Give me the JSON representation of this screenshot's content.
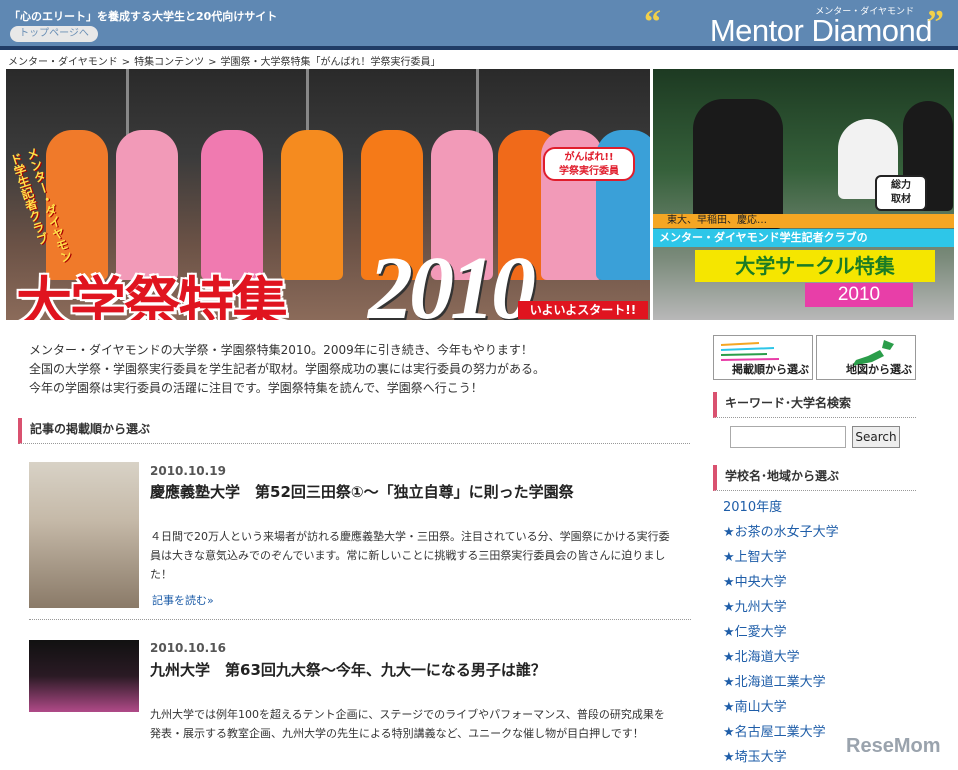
{
  "header": {
    "tagline": "「心のエリート」を養成する大学生と20代向けサイト",
    "top_link": "トップページへ",
    "logo_sub": "メンター・ダイヤモンド",
    "logo": "Mentor Diamond",
    "quote_open": "“",
    "quote_close": "”"
  },
  "breadcrumb": [
    "メンター・ダイヤモンド",
    "特集コンテンツ",
    "学園祭・大学祭特集「がんばれ！学祭実行委員」"
  ],
  "breadcrumb_sep": ">",
  "hero_left": {
    "club_label": "メンター・ダイヤモンド学生記者クラブ",
    "badge": "がんばれ!!\n学祭実行委員",
    "title": "大学祭特集",
    "year": "2010",
    "start": "いよいよスタート!!"
  },
  "hero_right": {
    "badge": "総力\n取材",
    "orange": "東大、早稲田、慶応…",
    "cyan": "メンター・ダイヤモンド学生記者クラブの",
    "yellow": "大学サークル特集",
    "pink": "2010"
  },
  "intro": [
    "メンター・ダイヤモンドの大学祭・学園祭特集2010。2009年に引き続き、今年もやります！",
    "全国の大学祭・学園祭実行委員を学生記者が取材。学園祭成功の裏には実行委員の努力がある。",
    "今年の学園祭は実行委員の活躍に注目です。学園祭特集を読んで、学園祭へ行こう！"
  ],
  "section_order": "記事の掲載順から選ぶ",
  "articles": [
    {
      "date": "2010.10.19",
      "title": "慶應義塾大学　第52回三田祭①～「独立自尊」に則った学園祭",
      "desc": "４日間で20万人という来場者が訪れる慶應義塾大学・三田祭。注目されている分、学園祭にかける実行委員は大きな意気込みでのぞんでいます。常に新しいことに挑戦する三田祭実行委員会の皆さんに迫りました！",
      "more": "記事を読む»"
    },
    {
      "date": "2010.10.16",
      "title": "九州大学　第63回九大祭～今年、九大一になる男子は誰？",
      "desc": "九州大学では例年100を超えるテント企画に、ステージでのライブやパフォーマンス、普段の研究成果を発表・展示する教室企画、九州大学の先生による特別講義など、ユニークな催し物が目白押しです！"
    }
  ],
  "sidebar": {
    "btn_order": "掲載順から選ぶ",
    "btn_map": "地図から選ぶ",
    "keyword_head": "キーワード･大学名検索",
    "search_value": "",
    "search_btn": "Search",
    "school_head": "学校名･地域から選ぶ",
    "year_label": "2010年度",
    "schools": [
      "★お茶の水女子大学",
      "★上智大学",
      "★中央大学",
      "★九州大学",
      "★仁愛大学",
      "★北海道大学",
      "★北海道工業大学",
      "★南山大学",
      "★名古屋工業大学",
      "★埼玉大学"
    ]
  },
  "watermark": "ReseMom",
  "colors": {
    "header_bg": "#5f88b3",
    "header_line": "#203c66",
    "accent_pink": "#d9516f",
    "link_blue": "#1e5da8",
    "hero_red": "#e0141f"
  }
}
